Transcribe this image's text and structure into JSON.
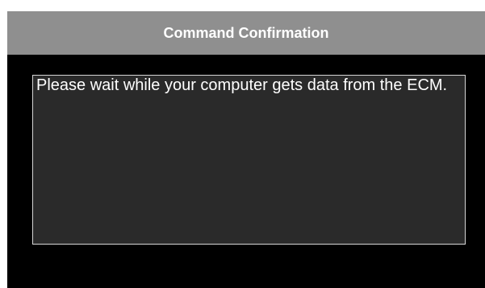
{
  "dialog": {
    "title": "Command Confirmation",
    "message": "Please wait while your computer gets data from the ECM."
  },
  "colors": {
    "title_bar_bg": "#8f8f8f",
    "dialog_bg": "#000000",
    "message_bg": "#2a2a2a",
    "text": "#ffffff"
  }
}
